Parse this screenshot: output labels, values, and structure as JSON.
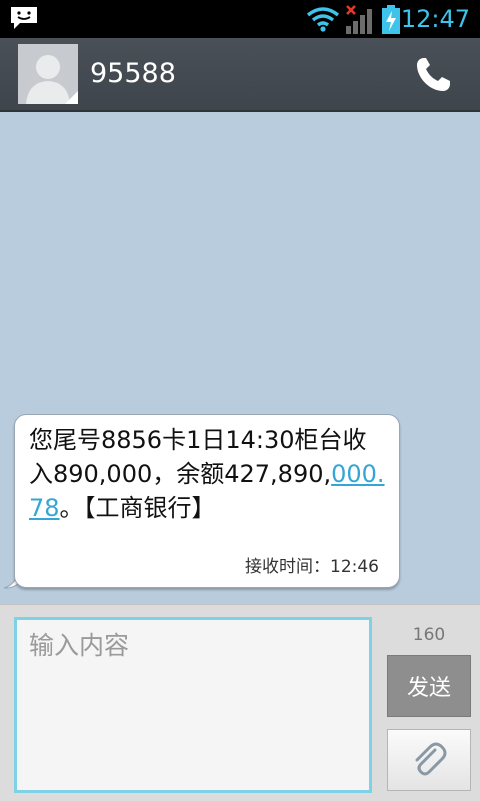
{
  "status_bar": {
    "time": "12:47",
    "icons": [
      "message-notification-icon",
      "wifi-icon",
      "no-signal-icon",
      "battery-charging-icon"
    ],
    "accent_color": "#3ec4ea"
  },
  "header": {
    "contact_name": "95588",
    "icons": [
      "avatar-placeholder",
      "phone-call-icon"
    ]
  },
  "message": {
    "text_part1": "您尾号8856卡1日14:30柜台收入890,000，余额427,890,",
    "text_link": "000.78",
    "text_part2": "。【工商银行】",
    "received_time": "接收时间：12:46"
  },
  "compose": {
    "placeholder": "输入内容",
    "char_count": "160",
    "send_label": "发送",
    "attach_icon": "paperclip-icon"
  },
  "colors": {
    "conversation_bg": "#b9ccde",
    "link": "#34a6d6",
    "input_border": "#7fd2e6",
    "send_button": "#8e8e8e"
  }
}
